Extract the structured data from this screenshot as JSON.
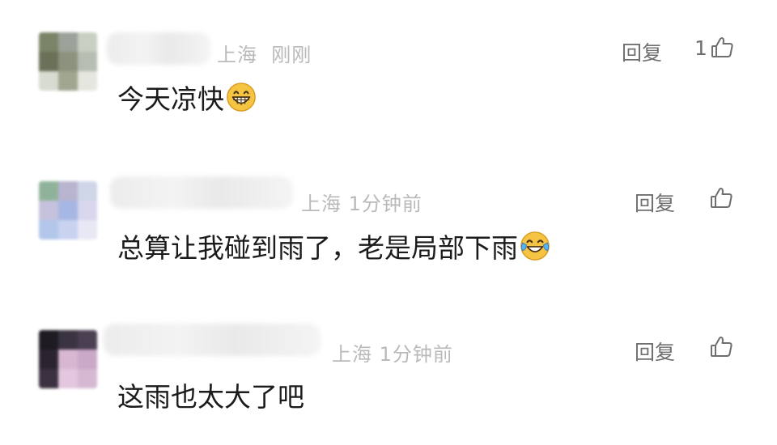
{
  "comments": [
    {
      "location": "上海",
      "time": "刚刚",
      "text": "今天凉快",
      "emoji": "grinning-face-icon",
      "reply_label": "回复",
      "like_count": "1",
      "avatar_colors": [
        "#7a8466",
        "#9aa29a",
        "#c9cfc2",
        "#6b7059",
        "#8d927f",
        "#b7bdb2",
        "#d7dbd1",
        "#a0a690",
        "#e4e6df"
      ]
    },
    {
      "location": "上海",
      "time": "1分钟前",
      "text": "总算让我碰到雨了，老是局部下雨",
      "emoji": "tears-of-joy-icon",
      "reply_label": "回复",
      "like_count": "",
      "avatar_colors": [
        "#8fb39a",
        "#b9b4cf",
        "#cfd6e8",
        "#c6c2dd",
        "#a7b7e3",
        "#d9d6ee",
        "#b2c7ea",
        "#c9d3f0",
        "#e7e8f4"
      ]
    },
    {
      "location": "上海",
      "time": "1分钟前",
      "text": "这雨也太大了吧",
      "emoji": "",
      "reply_label": "回复",
      "like_count": "",
      "avatar_colors": [
        "#1e1b22",
        "#3a3341",
        "#4b3f52",
        "#2a2430",
        "#d8b7d1",
        "#caa8c8",
        "#3b3140",
        "#e3c7df",
        "#d5b9d2"
      ]
    }
  ],
  "colors": {
    "meta": "#b9b9b9",
    "action": "#6f6f6f",
    "text": "#1b1b1b"
  }
}
